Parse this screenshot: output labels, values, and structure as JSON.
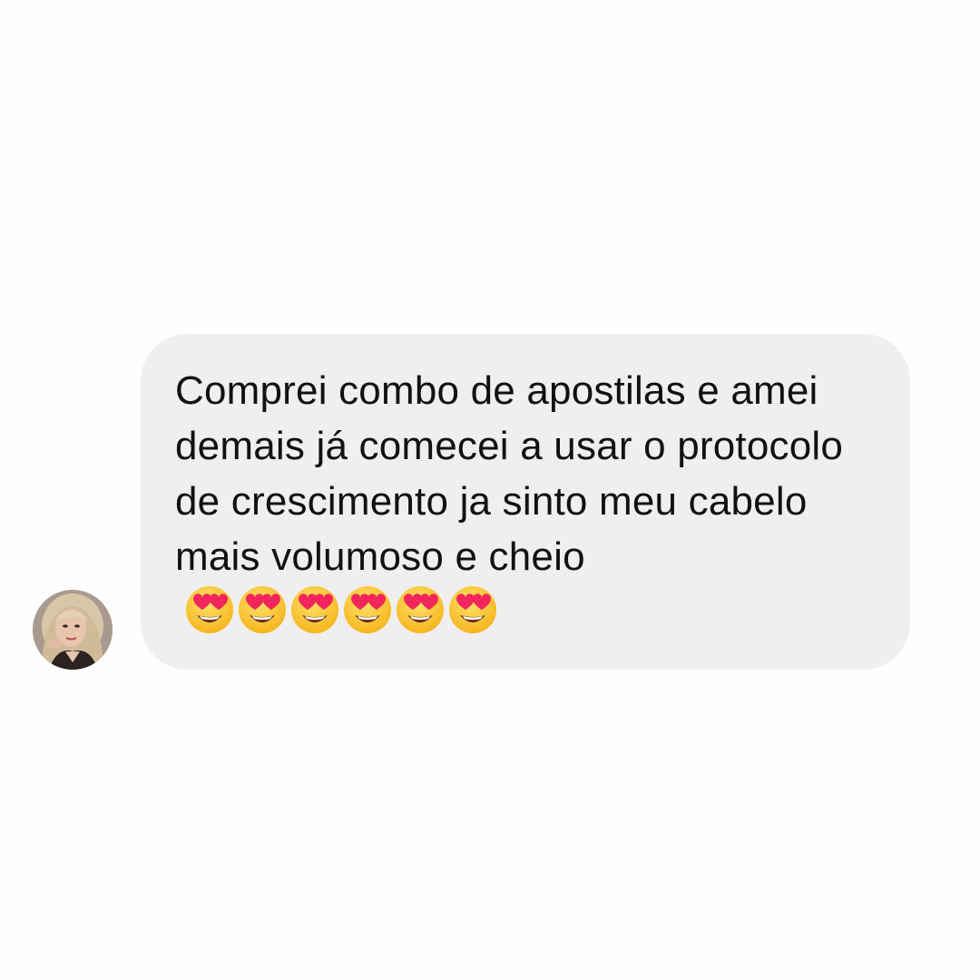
{
  "conversation": {
    "message": {
      "text": "Comprei combo de apostilas e amei demais já comecei a usar o protocolo de crescimento ja sinto meu cabelo mais volumoso e cheio",
      "emoji_name": "smiling-face-with-heart-eyes-icon",
      "emoji_count": 6
    },
    "sender": {
      "avatar": "profile-photo"
    }
  },
  "colors": {
    "background": "#fefefe",
    "bubble": "#efefef",
    "text": "#111111"
  }
}
